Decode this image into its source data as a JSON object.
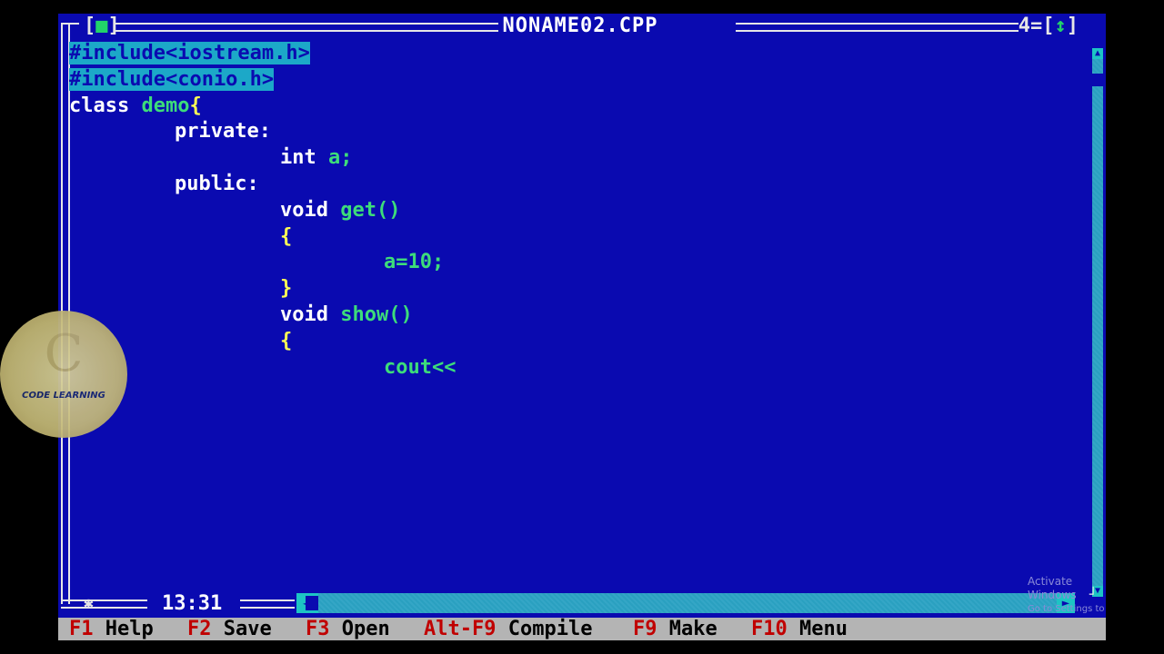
{
  "window": {
    "title": "NONAME02.CPP",
    "close_box_left": "[",
    "close_box_mark": "■",
    "close_box_right": "]",
    "window_number": "4",
    "zoom_box_left": "[",
    "zoom_box_mark": "↕",
    "zoom_box_right": "]",
    "cursor_position": "13:31",
    "modified_marker": "✱"
  },
  "code_lines": [
    "#include<iostream.h>",
    "#include<conio.h>",
    "class ",
    "demo",
    "{",
    "private:",
    "int ",
    "a;",
    "public:",
    "void ",
    "get()",
    "{",
    "a=10;",
    "}",
    "void ",
    "show()",
    "{",
    "cout<<"
  ],
  "statusbar": {
    "items": [
      {
        "key": "F1",
        "label": " Help"
      },
      {
        "key": "F2",
        "label": " Save"
      },
      {
        "key": "F3",
        "label": " Open"
      },
      {
        "key": "Alt-F9",
        "label": " Compile"
      },
      {
        "key": "F9",
        "label": " Make"
      },
      {
        "key": "F10",
        "label": " Menu"
      }
    ]
  },
  "watermark": {
    "line1": "Activate Windows",
    "line2": "Go to Settings to activate Windows."
  },
  "logo": {
    "text": "CODE LEARNING"
  },
  "colors": {
    "editor_bg": "#0a0ab0",
    "highlight": "#1ca8c8",
    "identifier": "#3ddc7a",
    "brace": "#ffff55",
    "status_bg": "#b4b4b4",
    "function_key": "#c00000"
  }
}
